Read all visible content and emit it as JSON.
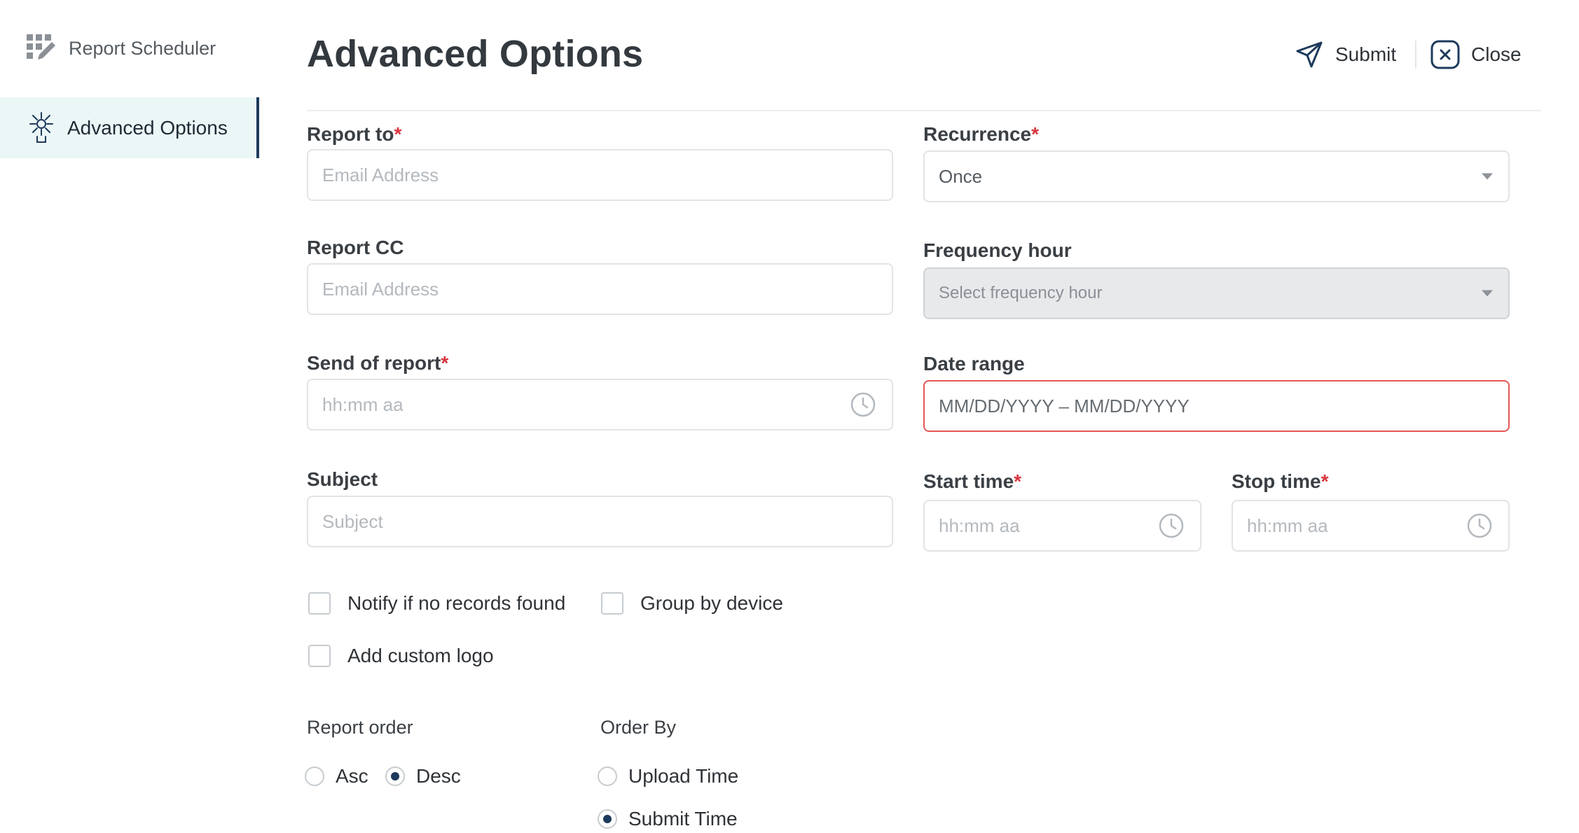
{
  "sidebar": {
    "app_label": "Report Scheduler",
    "items": [
      {
        "label": "Advanced Options",
        "active": true
      }
    ]
  },
  "header": {
    "title": "Advanced Options",
    "submit_label": "Submit",
    "close_label": "Close"
  },
  "form": {
    "report_to": {
      "label": "Report to",
      "required_mark": "*",
      "placeholder": "Email Address"
    },
    "report_cc": {
      "label": "Report CC",
      "placeholder": "Email Address"
    },
    "send_of_report": {
      "label": "Send of report",
      "required_mark": "*",
      "placeholder": "hh:mm aa"
    },
    "subject": {
      "label": "Subject",
      "placeholder": "Subject"
    },
    "recurrence": {
      "label": "Recurrence",
      "required_mark": "*",
      "value": "Once"
    },
    "frequency_hour": {
      "label": "Frequency hour",
      "placeholder": "Select frequency hour"
    },
    "date_range": {
      "label": "Date range",
      "placeholder": "MM/DD/YYYY – MM/DD/YYYY"
    },
    "start_time": {
      "label": "Start time",
      "required_mark": "*",
      "placeholder": "hh:mm aa"
    },
    "stop_time": {
      "label": "Stop time",
      "required_mark": "*",
      "placeholder": "hh:mm aa"
    },
    "checkboxes": {
      "notify": {
        "label": "Notify if no records found",
        "checked": false
      },
      "group_by_device": {
        "label": "Group by device",
        "checked": false
      },
      "custom_logo": {
        "label": "Add custom logo",
        "checked": false
      }
    },
    "report_order": {
      "label": "Report order",
      "options": [
        "Asc",
        "Desc"
      ],
      "selected": "Desc"
    },
    "order_by": {
      "label": "Order By",
      "options": [
        "Upload Time",
        "Submit Time"
      ],
      "selected": "Submit Time"
    }
  },
  "colors": {
    "accent": "#1d3a5c",
    "required": "#d9363e",
    "error_border": "#e35757",
    "active_bg": "#ebf6f6"
  }
}
